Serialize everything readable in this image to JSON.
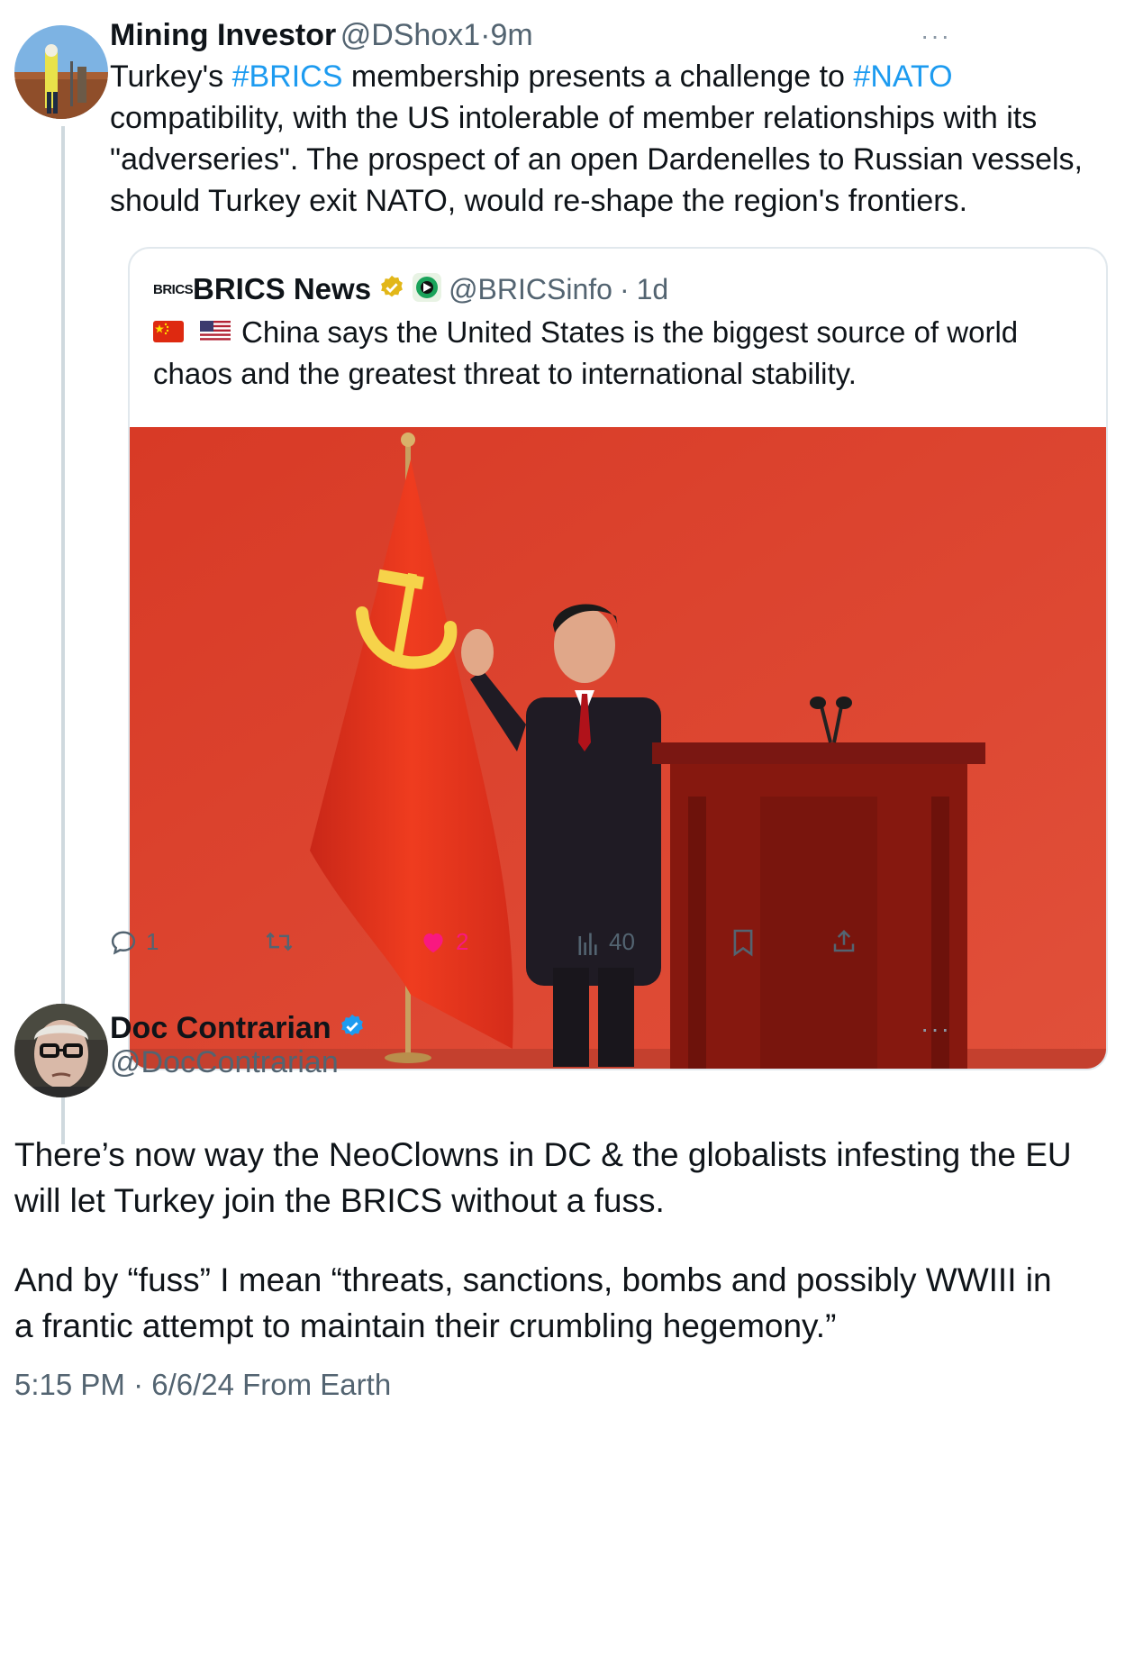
{
  "post1": {
    "author_name": "Mining Investor",
    "handle": "@DShox1",
    "separator": "·",
    "time": "9m",
    "more_label": "···",
    "text_parts": {
      "p1": "Turkey's ",
      "hashtag1": "#BRICS",
      "p2": " membership presents a challenge to ",
      "hashtag2": "#NATO",
      "line2": "compatibility, with the US intolerable of member relationships with its",
      "line3": "\"adverseries\". The prospect of an open Dardenelles to Russian vessels,",
      "line4": "should Turkey exit NATO, would re-shape the region's frontiers."
    },
    "quote": {
      "logo_text": "BRICS",
      "author_name": "BRICS News",
      "handle": "@BRICSinfo",
      "separator": "·",
      "time": "1d",
      "line1": "China says the United States is the biggest source of world",
      "line2": "chaos and the greatest threat to international stability."
    },
    "actions": {
      "replies": "1",
      "likes": "2",
      "views": "40"
    },
    "colors": {
      "link": "#1d9bf0",
      "like": "#f91880",
      "muted": "#536471"
    }
  },
  "post2": {
    "author_name": "Doc Contrarian",
    "handle": "@DocContrarian",
    "more_label": "···",
    "paragraph1_line1": "There’s now way the NeoClowns in DC & the globalists infesting the EU",
    "paragraph1_line2": "will let Turkey join the BRICS without a fuss.",
    "paragraph2_line1": "And by “fuss” I mean “threats, sanctions, bombs and possibly WWIII in",
    "paragraph2_line2": "a frantic attempt to maintain their crumbling hegemony.”",
    "timestamp": "5:15 PM · 6/6/24 From Earth"
  }
}
